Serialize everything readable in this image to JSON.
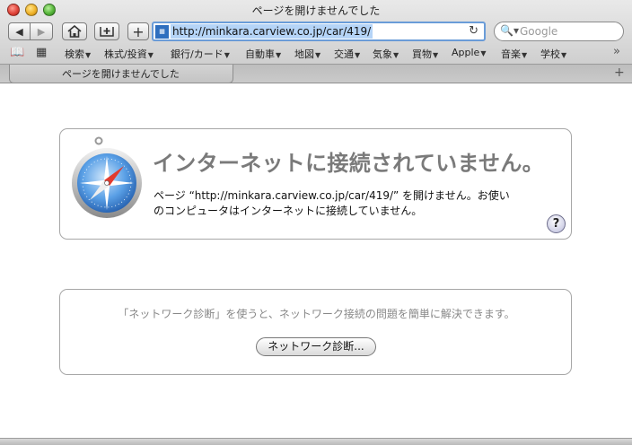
{
  "window": {
    "title": "ページを開けませんでした"
  },
  "toolbar": {
    "back_label": "◀",
    "forward_label": "▶",
    "new_tab_label": "+",
    "url": "http://minkara.carview.co.jp/car/419/",
    "search_placeholder": "Google"
  },
  "bookmarks": [
    {
      "label": "検索"
    },
    {
      "label": "株式/投資"
    },
    {
      "label": "銀行/カード"
    },
    {
      "label": "自動車"
    },
    {
      "label": "地図"
    },
    {
      "label": "交通"
    },
    {
      "label": "気象"
    },
    {
      "label": "買物"
    },
    {
      "label": "Apple"
    },
    {
      "label": "音楽"
    },
    {
      "label": "学校"
    }
  ],
  "tab": {
    "label": "ページを開けませんでした"
  },
  "error": {
    "headline": "インターネットに接続されていません。",
    "body_line1": "ページ “http://minkara.carview.co.jp/car/419/” を開けません。お使い",
    "body_line2": "のコンピュータはインターネットに接続していません。",
    "help_label": "?"
  },
  "diagnostics": {
    "text": "「ネットワーク診断」を使うと、ネットワーク接続の問題を簡単に解決できます。",
    "button_label": "ネットワーク診断..."
  },
  "icons": [
    "close-icon",
    "minimize-icon",
    "zoom-icon",
    "home-icon",
    "add-bookmark-icon",
    "reload-icon",
    "search-icon",
    "book-icon",
    "grid-icon",
    "safari-compass-icon"
  ]
}
